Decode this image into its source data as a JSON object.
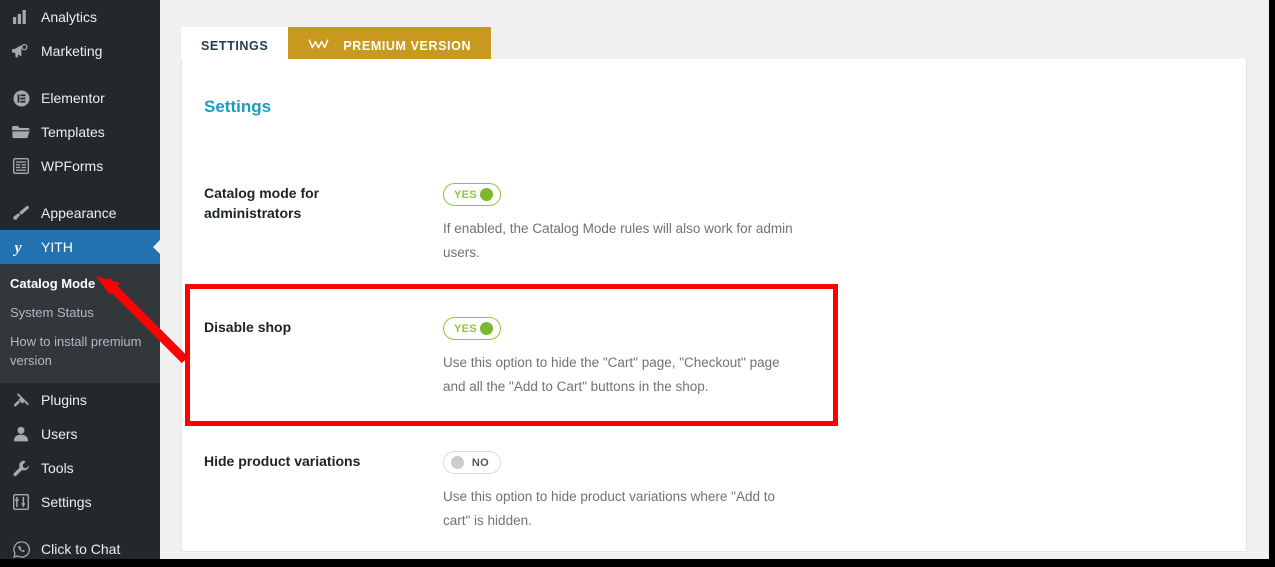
{
  "sidebar": {
    "items": [
      {
        "label": "Analytics",
        "icon": "bar-chart-icon",
        "active": false
      },
      {
        "label": "Marketing",
        "icon": "megaphone-icon",
        "active": false
      },
      {
        "label": "Elementor",
        "icon": "elementor-icon",
        "active": false
      },
      {
        "label": "Templates",
        "icon": "folder-icon",
        "active": false
      },
      {
        "label": "WPForms",
        "icon": "forms-icon",
        "active": false
      },
      {
        "label": "Appearance",
        "icon": "paintbrush-icon",
        "active": false
      },
      {
        "label": "YITH",
        "icon": "yith-logo-icon",
        "active": true
      },
      {
        "label": "Plugins",
        "icon": "plug-icon",
        "active": false
      },
      {
        "label": "Users",
        "icon": "user-icon",
        "active": false
      },
      {
        "label": "Tools",
        "icon": "wrench-icon",
        "active": false
      },
      {
        "label": "Settings",
        "icon": "sliders-icon",
        "active": false
      },
      {
        "label": "Click to Chat",
        "icon": "whatsapp-icon",
        "active": false
      }
    ],
    "submenu": [
      {
        "label": "Catalog Mode",
        "current": true
      },
      {
        "label": "System Status",
        "current": false
      },
      {
        "label": "How to install premium version",
        "current": false
      }
    ],
    "active_color": "#2271b1",
    "background_color": "#23282d",
    "submenu_background_color": "#32373c"
  },
  "tabs": [
    {
      "label": "SETTINGS",
      "active": true,
      "icon": null
    },
    {
      "label": "PREMIUM VERSION",
      "active": false,
      "icon": "crown-icon",
      "color": "#c8981f"
    }
  ],
  "panel": {
    "section_title": "Settings",
    "section_title_color": "#1a9dc1",
    "rows": [
      {
        "label": "Catalog mode for administrators",
        "toggle": {
          "state": "on",
          "label": "YES"
        },
        "description": "If enabled, the Catalog Mode rules will also work for admin users."
      },
      {
        "label": "Disable shop",
        "toggle": {
          "state": "on",
          "label": "YES"
        },
        "description": "Use this option to hide the \"Cart\" page, \"Checkout\" page and all the \"Add to Cart\" buttons in the shop."
      },
      {
        "label": "Hide product variations",
        "toggle": {
          "state": "off",
          "label": "NO"
        },
        "description": "Use this option to hide product variations where \"Add to cart\" is hidden."
      }
    ]
  },
  "annotations": {
    "highlight_color": "#fe0000",
    "highlight_target": "Disable shop",
    "arrow_points_to": "Catalog Mode"
  }
}
